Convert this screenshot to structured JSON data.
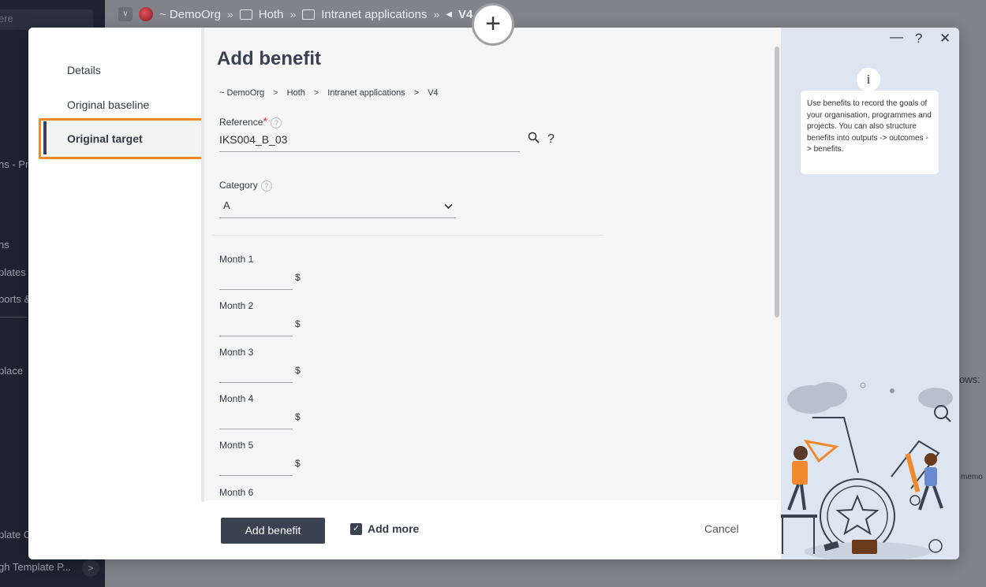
{
  "background": {
    "sidebar_items": [
      "ere",
      "ns - Pro",
      "ns",
      "plates",
      "ports &",
      "place",
      "plate C",
      "gh Template P..."
    ],
    "breadcrumb": [
      "~ DemoOrg",
      "Hoth",
      "Intranet applications",
      "V4"
    ],
    "right_text": [
      "ows:",
      "memo"
    ]
  },
  "modal": {
    "nav": {
      "items": [
        "Details",
        "Original baseline",
        "Original target"
      ],
      "active": "Original target"
    },
    "title": "Add benefit",
    "breadcrumb": [
      "~ DemoOrg",
      "Hoth",
      "Intranet applications",
      "V4"
    ],
    "reference": {
      "label": "Reference",
      "required_mark": "*",
      "value": "IKS004_B_03",
      "help": "?"
    },
    "category": {
      "label": "Category",
      "value": "A"
    },
    "months": [
      {
        "label": "Month 1",
        "currency": "$"
      },
      {
        "label": "Month 2",
        "currency": "$"
      },
      {
        "label": "Month 3",
        "currency": "$"
      },
      {
        "label": "Month 4",
        "currency": "$"
      },
      {
        "label": "Month 5",
        "currency": "$"
      },
      {
        "label": "Month 6"
      }
    ],
    "footer": {
      "add_button": "Add benefit",
      "add_more": "Add more",
      "add_more_checked": true,
      "cancel": "Cancel"
    },
    "window_controls": {
      "minimize": "—",
      "help": "?",
      "close": "✕"
    },
    "tip": {
      "icon": "i",
      "text": "Use benefits to record the goals of your organisation, programmes and projects. You can also structure benefits into outputs -> outcomes -> benefits."
    }
  },
  "colors": {
    "accent_dark": "#3a4150",
    "highlight": "#ef8a2e",
    "help_panel": "#dde5f0"
  }
}
